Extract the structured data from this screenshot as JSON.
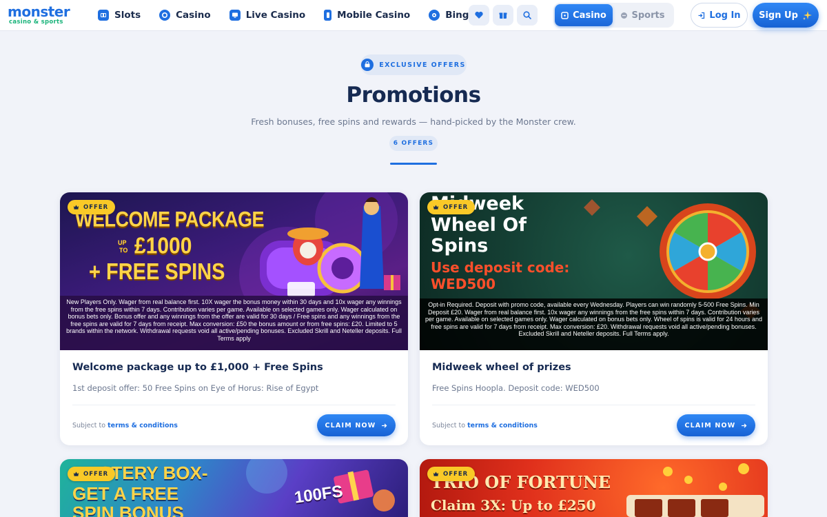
{
  "brand": {
    "logo_main": "monster",
    "logo_sub": "casino & sports"
  },
  "nav": [
    {
      "label": "Slots",
      "icon": "slots-icon"
    },
    {
      "label": "Casino",
      "icon": "casino-chip-icon"
    },
    {
      "label": "Live Casino",
      "icon": "live-casino-monitor-icon"
    },
    {
      "label": "Mobile Casino",
      "icon": "mobile-icon"
    },
    {
      "label": "Bingo",
      "icon": "bingo-ball-icon"
    }
  ],
  "header_icons": [
    "heart-icon",
    "gift-icon",
    "search-icon"
  ],
  "mode_toggle": {
    "active": "Casino",
    "inactive": "Sports"
  },
  "auth": {
    "login": "Log In",
    "signup": "Sign Up"
  },
  "hero": {
    "eyebrow": "EXCLUSIVE OFFERS",
    "title": "Promotions",
    "subtitle": "Fresh bonuses, free spins and rewards — hand-picked by the Monster crew.",
    "count": "6 OFFERS"
  },
  "colors": {
    "accent": "#1f6fe0",
    "offer_tag": "#f9c927",
    "page_bg": "#f1f3f9"
  },
  "promos": [
    {
      "tag": "OFFER",
      "banner_line1": "WELCOME PACKAGE",
      "banner_up": "UP",
      "banner_to": "TO",
      "banner_amount": "£1000",
      "banner_line3": "+ FREE SPINS",
      "fine_print": "New Players Only. Wager from real balance first. 10X wager the bonus money within 30 days and 10x wager any winnings from the free spins within 7 days. Contribution varies per game. Available on selected games only. Wager calculated on bonus bets only. Bonus offer and any winnings from the offer are valid for 30 days / Free spins and any winnings from the free spins are valid for 7 days from receipt. Max conversion: £50 the bonus amount or from free spins: £20. Limited to 5 brands within the network. Withdrawal requests void all active/pending bonuses. Excluded Skrill and Neteller deposits. Full Terms apply",
      "title": "Welcome package up to £1,000 + Free Spins",
      "description": "1st deposit offer: 50 Free Spins on Eye of Horus: Rise of Egypt",
      "terms_prefix": "Subject to",
      "terms_link": "terms & conditions",
      "cta": "CLAIM NOW"
    },
    {
      "tag": "OFFER",
      "banner_line1": "Midweek",
      "banner_line2": "Wheel Of",
      "banner_line3": "Spins",
      "banner_code_label": "Use deposit code:",
      "banner_code": "WED500",
      "fine_print": "Opt-in Required. Deposit with promo code, available every Wednesday. Players can win randomly 5-500 Free Spins. Min Deposit £20. Wager from real balance first. 10x wager any winnings from the free spins within 7 days. Contribution varies per game. Available on selected games only. Wager calculated on bonus bets only. Wheel of spins is valid for 24 hours and free spins are valid for 7 days from receipt. Max conversion: £20. Withdrawal requests void all active/pending bonuses. Excluded Skrill and Neteller deposits. Full Terms apply.",
      "title": "Midweek wheel of prizes",
      "description": "Free Spins Hoopla. Deposit code: WED500",
      "terms_prefix": "Subject to",
      "terms_link": "terms & conditions",
      "cta": "CLAIM NOW"
    },
    {
      "tag": "OFFER",
      "banner_line1": "MYSTERY BOX-",
      "banner_line2": "GET A FREE",
      "banner_line3": "SPIN BONUS",
      "banner_badge": "100FS"
    },
    {
      "tag": "OFFER",
      "banner_line1": "TRIO OF FORTUNE",
      "banner_line2": "Claim 3X: Up to £250"
    }
  ]
}
